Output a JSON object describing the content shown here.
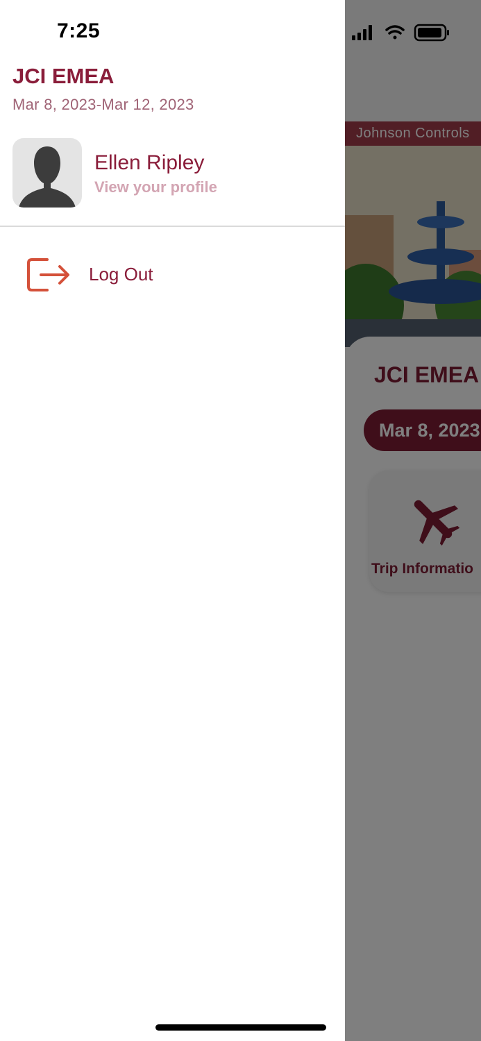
{
  "status_bar": {
    "time": "7:25",
    "icons": [
      "signal-icon",
      "wifi-icon",
      "battery-icon"
    ]
  },
  "drawer": {
    "event_title": "JCI EMEA",
    "event_dates": "Mar 8, 2023-Mar 12, 2023",
    "user": {
      "name": "Ellen Ripley",
      "profile_link": "View your profile",
      "avatar_icon": "person-silhouette-icon"
    },
    "menu": [
      {
        "label": "Log Out",
        "icon": "logout-icon"
      }
    ]
  },
  "background_app": {
    "brand_label": "Johnson Controls",
    "event_title": "JCI EMEA",
    "date_pill": "Mar 8, 2023",
    "tiles": [
      {
        "label": "Trip Informatio",
        "icon": "airplane-icon"
      }
    ]
  },
  "colors": {
    "brand": "#8a1d3a",
    "accent_red": "#d4513a",
    "muted_link": "#d3a5b3"
  }
}
